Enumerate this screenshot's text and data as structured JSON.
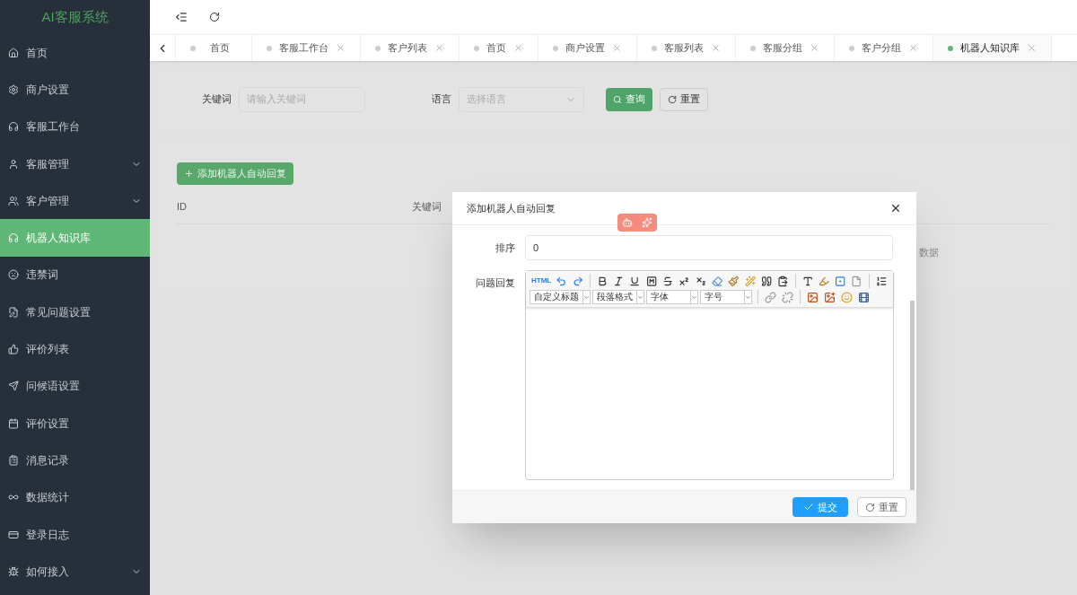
{
  "sidebar": {
    "title": "AI客服系统",
    "items": [
      {
        "label": "首页",
        "kind": "link",
        "selected": false
      },
      {
        "label": "商户设置",
        "kind": "link",
        "selected": false
      },
      {
        "label": "客服工作台",
        "kind": "link",
        "selected": false
      },
      {
        "label": "客服管理",
        "kind": "group",
        "selected": false,
        "expanded": false
      },
      {
        "label": "客户管理",
        "kind": "group",
        "selected": false,
        "expanded": false
      },
      {
        "label": "机器人知识库",
        "kind": "link",
        "selected": true
      },
      {
        "label": "违禁词",
        "kind": "link",
        "selected": false
      },
      {
        "label": "常见问题设置",
        "kind": "link",
        "selected": false
      },
      {
        "label": "评价列表",
        "kind": "link",
        "selected": false
      },
      {
        "label": "问候语设置",
        "kind": "link",
        "selected": false
      },
      {
        "label": "评价设置",
        "kind": "link",
        "selected": false
      },
      {
        "label": "消息记录",
        "kind": "link",
        "selected": false
      },
      {
        "label": "数据统计",
        "kind": "link",
        "selected": false
      },
      {
        "label": "登录日志",
        "kind": "link",
        "selected": false
      },
      {
        "label": "如何接入",
        "kind": "group",
        "selected": false,
        "expanded": false
      }
    ]
  },
  "tabs": [
    {
      "label": "首页",
      "closable": false,
      "selected": false
    },
    {
      "label": "客服工作台",
      "closable": true,
      "selected": false
    },
    {
      "label": "客户列表",
      "closable": true,
      "selected": false
    },
    {
      "label": "首页",
      "closable": true,
      "selected": false
    },
    {
      "label": "商户设置",
      "closable": true,
      "selected": false
    },
    {
      "label": "客服列表",
      "closable": true,
      "selected": false
    },
    {
      "label": "客服分组",
      "closable": true,
      "selected": false
    },
    {
      "label": "客户分组",
      "closable": true,
      "selected": false
    },
    {
      "label": "机器人知识库",
      "closable": true,
      "selected": true
    }
  ],
  "search": {
    "keyword_label": "关键词",
    "keyword_placeholder": "请输入关键词",
    "language_label": "语言",
    "language_placeholder": "选择语言",
    "query_button": "查询",
    "reset_button": "重置"
  },
  "add_button": "添加机器人自动回复",
  "table": {
    "columns": [
      "ID",
      "关键词"
    ],
    "empty_text": "数据"
  },
  "dialog": {
    "title": "添加机器人自动回复",
    "order_label": "排序",
    "order_value": "0",
    "reply_label": "问题回复",
    "editor": {
      "html_button": "HTML",
      "selects": [
        "自定义标题",
        "段落格式",
        "字体",
        "字号"
      ]
    },
    "submit_button": "提交",
    "reset_button": "重置"
  }
}
